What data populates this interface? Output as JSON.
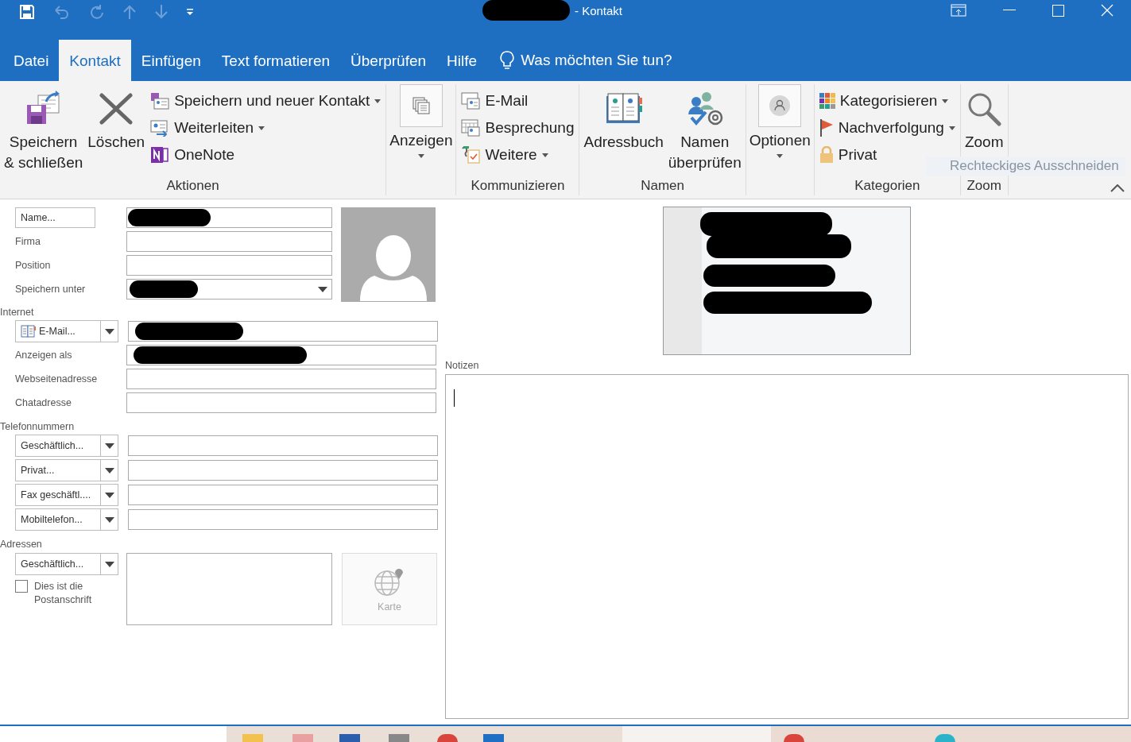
{
  "window": {
    "title": "- Kontakt"
  },
  "tabs": [
    {
      "label": "Datei",
      "selected": false
    },
    {
      "label": "Kontakt",
      "selected": true
    },
    {
      "label": "Einfügen",
      "selected": false
    },
    {
      "label": "Text formatieren",
      "selected": false
    },
    {
      "label": "Überprüfen",
      "selected": false
    },
    {
      "label": "Hilfe",
      "selected": false
    }
  ],
  "tell_me": "Was möchten Sie tun?",
  "ribbon_groups": [
    {
      "label": "Aktionen",
      "items": [
        {
          "kind": "large",
          "label": "Speichern\n& schließen",
          "dropdown": false
        },
        {
          "kind": "large",
          "label": "Löschen",
          "dropdown": false
        },
        {
          "kind": "small",
          "label": "Speichern und neuer Kontakt",
          "dropdown": true
        },
        {
          "kind": "small",
          "label": "Weiterleiten",
          "dropdown": true
        },
        {
          "kind": "small",
          "label": "OneNote",
          "dropdown": false
        }
      ]
    },
    {
      "items": [
        {
          "kind": "boxed",
          "label": "Anzeigen",
          "dropdown": true
        }
      ]
    },
    {
      "label": "Kommunizieren",
      "items": [
        {
          "kind": "small",
          "label": "E-Mail",
          "dropdown": false
        },
        {
          "kind": "small",
          "label": "Besprechung",
          "dropdown": false
        },
        {
          "kind": "small",
          "label": "Weitere",
          "dropdown": true
        }
      ]
    },
    {
      "label": "Namen",
      "items": [
        {
          "kind": "large",
          "label": "Adressbuch",
          "dropdown": false
        },
        {
          "kind": "large",
          "label": "Namen\nüberprüfen",
          "dropdown": false
        }
      ]
    },
    {
      "items": [
        {
          "kind": "boxed",
          "label": "Optionen",
          "dropdown": true
        }
      ]
    },
    {
      "label": "Kategorien",
      "items": [
        {
          "kind": "small",
          "label": "Kategorisieren",
          "dropdown": true
        },
        {
          "kind": "small",
          "label": "Nachverfolgung",
          "dropdown": true
        },
        {
          "kind": "small",
          "label": "Privat",
          "dropdown": false
        }
      ]
    },
    {
      "label": "Zoom",
      "items": [
        {
          "kind": "large",
          "label": "Zoom",
          "dropdown": false
        }
      ]
    }
  ],
  "overlay_hint": "Rechteckiges Ausschneiden",
  "form": {
    "name_button": "Name...",
    "top_fields": [
      {
        "label": "Firma",
        "dropdown": false
      },
      {
        "label": "Position",
        "dropdown": false
      },
      {
        "label": "Speichern unter",
        "dropdown": true
      }
    ],
    "internet": {
      "heading": "Internet",
      "email_button": "E-Mail...",
      "fields": [
        {
          "label": "Anzeigen als"
        },
        {
          "label": "Webseitenadresse"
        },
        {
          "label": "Chatadresse"
        }
      ]
    },
    "phones": {
      "heading": "Telefonnummern",
      "buttons": [
        "Geschäftlich...",
        "Privat...",
        "Fax geschäftl....",
        "Mobiltelefon..."
      ]
    },
    "addresses": {
      "heading": "Adressen",
      "button": "Geschäftlich...",
      "postal": {
        "label": "Dies ist die Postanschrift",
        "checked": false
      },
      "map": {
        "label": "Karte",
        "disabled": true
      }
    },
    "notes_label": "Notizen"
  }
}
